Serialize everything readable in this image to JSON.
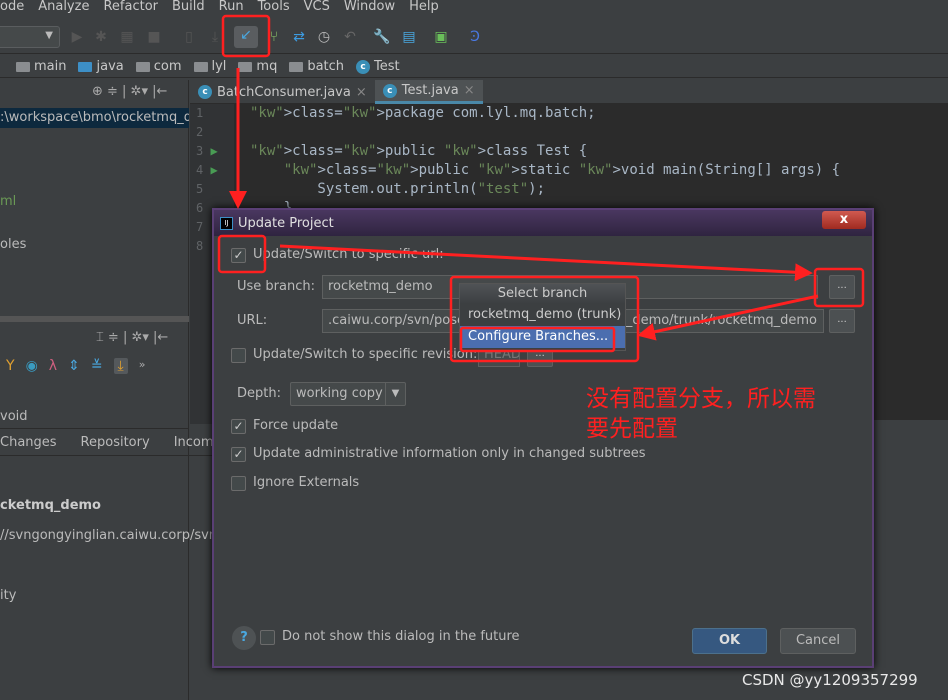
{
  "menu": [
    "ode",
    "Analyze",
    "Refactor",
    "Build",
    "Run",
    "Tools",
    "VCS",
    "Window",
    "Help"
  ],
  "breadcrumb": [
    "main",
    "java",
    "com",
    "lyl",
    "mq",
    "batch",
    "Test"
  ],
  "editor_tabs": [
    {
      "label": "BatchConsumer.java",
      "active": false
    },
    {
      "label": "Test.java",
      "active": true
    }
  ],
  "code_lines": [
    "package com.lyl.mq.batch;",
    "",
    "public class Test {",
    "    public static void main(String[] args) {",
    "        System.out.println(\"test\");",
    "    }",
    "",
    ""
  ],
  "line_numbers": [
    "1",
    "2",
    "3",
    "4",
    "5",
    "6",
    "7",
    "8"
  ],
  "left_panel": {
    "path": ":\\workspace\\bmo\\rocketmq_d",
    "item_ml": "ml",
    "item_oles": "oles",
    "item_void": "void",
    "tabs": [
      "Changes",
      "Repository",
      "Incomin"
    ],
    "repo_name": "cketmq_demo",
    "repo_url": "//svngongyinglian.caiwu.corp/svn/",
    "item_ity": "ity"
  },
  "dialog": {
    "title": "Update Project",
    "switch_url_label": "Update/Switch to specific url:",
    "switch_url_checked": true,
    "use_branch_label": "Use branch:",
    "use_branch_value": "rocketmq_demo",
    "url_label": "URL:",
    "url_value_left": ".caiwu.corp/svn/pose",
    "url_value_right": "_demo/trunk/rocketmq_demo",
    "revision_label": "Update/Switch to specific revision:",
    "revision_checked": false,
    "revision_value": "HEAD",
    "depth_label": "Depth:",
    "depth_value": "working copy",
    "force_update_label": "Force update",
    "force_update_checked": true,
    "update_admin_label": "Update administrative information only in changed subtrees",
    "update_admin_checked": true,
    "ignore_externals_label": "Ignore Externals",
    "ignore_externals_checked": false,
    "do_not_show_label": "Do not show this dialog in the future",
    "ok_label": "OK",
    "cancel_label": "Cancel",
    "browse_label": "..."
  },
  "branch_popup": {
    "title": "Select branch",
    "items": [
      "rocketmq_demo (trunk)",
      "Configure Branches..."
    ],
    "selected": 1
  },
  "annotation": {
    "text_line1": "没有配置分支，所以需",
    "text_line2": "要先配置",
    "color": "#ff2020"
  },
  "watermark": "CSDN @yy1209357299"
}
